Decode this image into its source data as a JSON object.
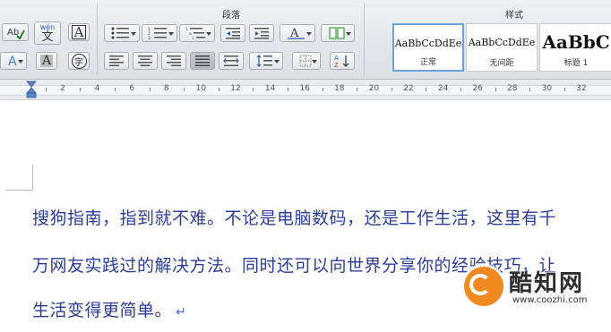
{
  "ribbon": {
    "paragraph_group_title": "段落",
    "styles_group_title": "样式",
    "font_buttons": {
      "phonetic_label": "wén",
      "phonetic_char": "文",
      "border_char": "A",
      "shade_char": "A",
      "enclose_char": "字"
    },
    "styles": [
      {
        "sample": "AaBbCcDdEe",
        "name": "正常",
        "selected": true
      },
      {
        "sample": "AaBbCcDdEe",
        "name": "无间距",
        "selected": false
      },
      {
        "sample": "AaBbC",
        "name": "标题 1",
        "selected": false
      }
    ]
  },
  "ruler": {
    "ticks": [
      "2",
      "4",
      "6",
      "8",
      "10",
      "12",
      "14",
      "16",
      "18",
      "20",
      "22",
      "24",
      "26",
      "28",
      "30",
      "32"
    ]
  },
  "document": {
    "lines": [
      "搜狗指南，指到就不难。不论是电脑数码，还是工作生活，这里有千",
      "万网友实践过的解决方法。同时还可以向世界分享你的经验技巧，让",
      "生活变得更简单。"
    ],
    "paragraph_mark": "↵"
  },
  "watermark": {
    "title": "酷知网",
    "url": "www.coozhi.com"
  },
  "colors": {
    "text": "#2b3c9a",
    "selected_style_border": "#6da2d9",
    "watermark_logo": "#f08a20"
  }
}
